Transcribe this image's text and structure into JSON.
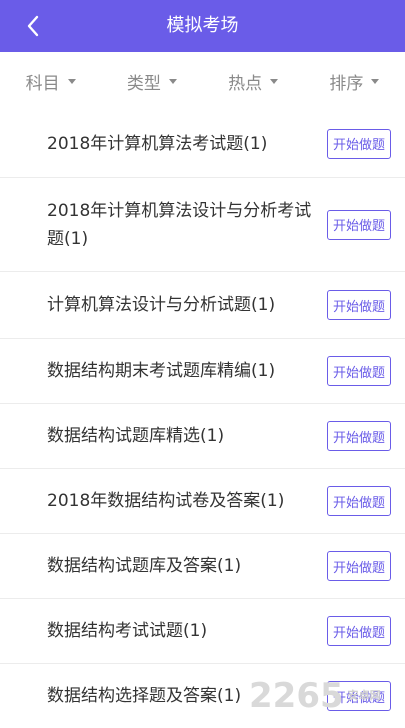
{
  "header": {
    "title": "模拟考场"
  },
  "filters": [
    {
      "label": "科目"
    },
    {
      "label": "类型"
    },
    {
      "label": "热点"
    },
    {
      "label": "排序"
    }
  ],
  "items": [
    {
      "label": "2018年计算机算法考试题(1)",
      "button": "开始做题"
    },
    {
      "label": "2018年计算机算法设计与分析考试题(1)",
      "button": "开始做题"
    },
    {
      "label": "计算机算法设计与分析试题(1)",
      "button": "开始做题"
    },
    {
      "label": "数据结构期末考试题库精编(1)",
      "button": "开始做题"
    },
    {
      "label": "数据结构试题库精选(1)",
      "button": "开始做题"
    },
    {
      "label": "2018年数据结构试卷及答案(1)",
      "button": "开始做题"
    },
    {
      "label": "数据结构试题库及答案(1)",
      "button": "开始做题"
    },
    {
      "label": "数据结构考试试题(1)",
      "button": "开始做题"
    },
    {
      "label": "数据结构选择题及答案(1)",
      "button": "开始做题"
    }
  ],
  "watermark": {
    "text": "2265",
    "sub": "安卓网"
  },
  "colors": {
    "accent": "#6a5ce8"
  }
}
